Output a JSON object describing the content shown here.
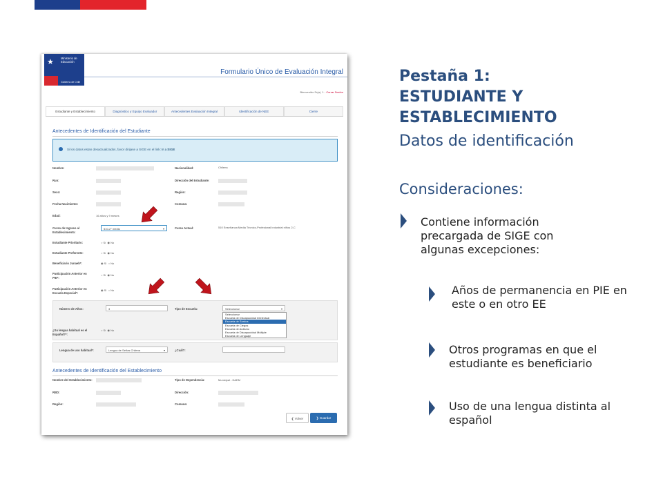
{
  "form": {
    "ministry_line1": "Ministerio de",
    "ministry_line2": "Educación",
    "gov_line": "Gobierno de Chile",
    "title": "Formulario Único de Evaluación Integral",
    "welcome": "Bienvenido Sr(a). 1 -",
    "logout": "Cerrar Sesión",
    "tabs": [
      "Estudiante y Establecimiento",
      "Diagnóstico y Equipo Evaluador",
      "Antecedentes Evaluación Integral",
      "Identificación de NEE",
      "Cierre"
    ],
    "section1": "Antecedentes de Identificación del Estudiante",
    "alert_text": "Si los datos estan desactualizados, favor dirijase a SIGE en el link:",
    "alert_link": "Ir a SIGE",
    "labels": {
      "nombre": "Nombre:",
      "run": "Run:",
      "sexo": "Sexo:",
      "fecha": "Fecha Nacimiento:",
      "edad": "Edad:",
      "curso_ingreso": "Curso de Ingreso al Establecimiento:",
      "prioritario": "Estudiante Prioritario:",
      "preferente": "Estudiante Preferente:",
      "junaeb": "Beneficiario Junaeb*:",
      "pie": "Participación Anterior en PIE*:",
      "especial": "Participación Anterior en Escuela Especial*:",
      "anios": "Número de Años:",
      "tipo_escuela": "Tipo de Escuela:",
      "lengua": "¿Su lengua habitual es el Español?*:",
      "lengua_uso": "Lengua de uso habitual*:",
      "cual": "¿Cuál?:",
      "nacionalidad": "Nacionalidad:",
      "direccion": "Dirección del Estudiante:",
      "region": "Región:",
      "comuna": "Comuna:",
      "curso_actual": "Curso Actual:"
    },
    "values": {
      "nacionalidad": "Chilena",
      "edad": "16 años y 9 meses",
      "curso_ingreso": "510-2° medio",
      "curso_actual": "510 Enseñanza Media Técnico-Profesional Industrial niños 2-C",
      "anios": "3",
      "tipo_escuela": "Seleccionar",
      "lengua_uso": "Lengua de Señas Chilena"
    },
    "radio_si": "Sí",
    "radio_no": "No",
    "dropdown_options": [
      "Seleccionar",
      "Escuela de Discapacidad Intelectual",
      "Escuela de Sordos",
      "Escuela de Ciegos",
      "Escuela de Autismo",
      "Escuela de Discapacidad Múltiple",
      "Escuela de Lenguaje"
    ],
    "section2": "Antecedentes de Identificación del Establecimiento",
    "labels2": {
      "nombre_est": "Nombre del Establecimiento:",
      "rbd": "RBD:",
      "region": "Región:",
      "dependencia": "Tipo de Dependencia:",
      "direccion": "Dirección:",
      "comuna": "Comuna:"
    },
    "dependencia_value": "Municipal - DAEM",
    "back": "Volver",
    "save": "Guardar"
  },
  "slide": {
    "title_line1": "Pestaña 1:",
    "title_line2": "ESTUDIANTE Y",
    "title_line3": "ESTABLECIMIENTO",
    "subtitle": "Datos de identificación",
    "considerations": "Consideraciones:",
    "bullet_main": "Contiene información precargada de SIGE con algunas excepciones:",
    "bullets": [
      "Años de permanencia en PIE en este o en otro EE",
      "Otros programas en que el estudiante es beneficiario",
      "Uso de una lengua distinta al español"
    ]
  },
  "colors": {
    "accent": "#2b4e7e",
    "blue": "#1d3f8c",
    "red": "#e3242b",
    "arrow": "#c0141c"
  }
}
